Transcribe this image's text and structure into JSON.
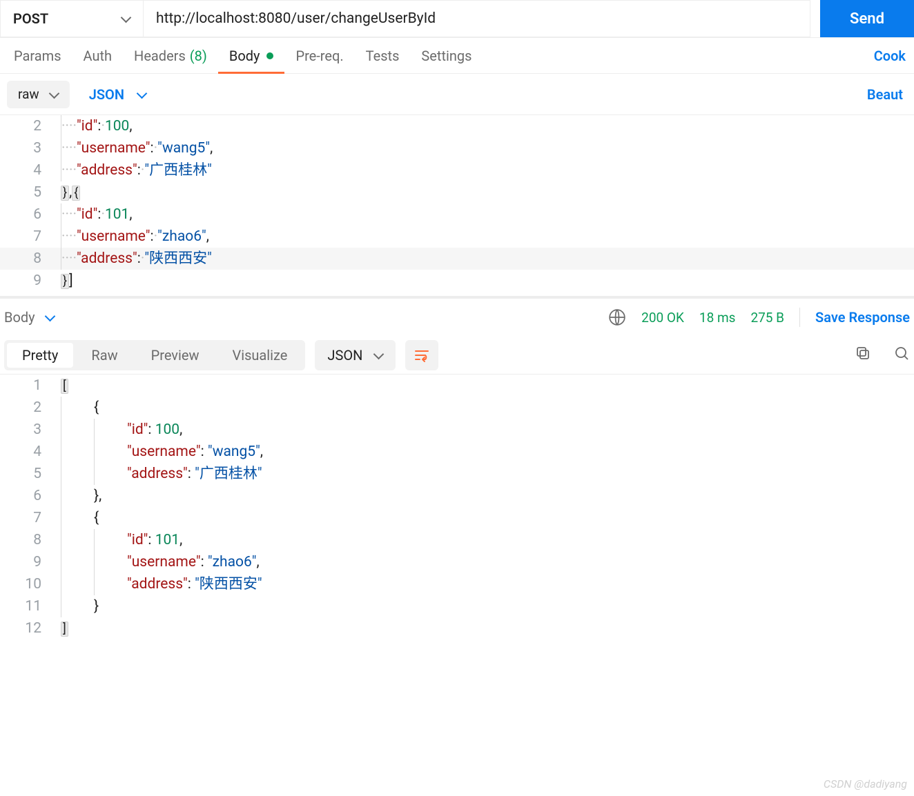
{
  "request": {
    "method": "POST",
    "url": "http://localhost:8080/user/changeUserById",
    "send_label": "Send"
  },
  "tabs": {
    "params": "Params",
    "auth": "Auth",
    "headers": "Headers",
    "headers_count": "(8)",
    "body": "Body",
    "prereq": "Pre-req.",
    "tests": "Tests",
    "settings": "Settings",
    "cookies": "Cook"
  },
  "body_toolbar": {
    "raw": "raw",
    "format": "JSON",
    "beautify": "Beaut"
  },
  "request_editor": {
    "lines": [
      {
        "n": "2",
        "dots": "····",
        "key": "\"id\"",
        "sep": ":·",
        "val": "100",
        "val_type": "num",
        "tail": ","
      },
      {
        "n": "3",
        "dots": "····",
        "key": "\"username\"",
        "sep": ":·",
        "val": "\"wang5\"",
        "val_type": "str",
        "tail": ","
      },
      {
        "n": "4",
        "dots": "····",
        "key": "\"address\"",
        "sep": ":·",
        "val": "\"广西桂林\"",
        "val_type": "str",
        "tail": ""
      },
      {
        "n": "5",
        "raw": "},{",
        "fold": true
      },
      {
        "n": "6",
        "dots": "····",
        "key": "\"id\"",
        "sep": ":·",
        "val": "101",
        "val_type": "num",
        "tail": ","
      },
      {
        "n": "7",
        "dots": "····",
        "key": "\"username\"",
        "sep": ":·",
        "val": "\"zhao6\"",
        "val_type": "str",
        "tail": ","
      },
      {
        "n": "8",
        "dots": "····",
        "key": "\"address\"",
        "sep": ":·",
        "val": "\"陕西西安\"",
        "val_type": "str",
        "tail": "",
        "hl": true
      },
      {
        "n": "9",
        "raw": "}]",
        "fold": true
      }
    ]
  },
  "response_bar": {
    "body_label": "Body",
    "status": "200 OK",
    "time": "18 ms",
    "size": "275 B",
    "save": "Save Response"
  },
  "response_tabs": {
    "pretty": "Pretty",
    "raw": "Raw",
    "preview": "Preview",
    "visualize": "Visualize",
    "format": "JSON"
  },
  "response_editor": {
    "lines": [
      {
        "n": "1",
        "indent": 0,
        "raw": "[",
        "fold": true
      },
      {
        "n": "2",
        "indent": 1,
        "raw": "{"
      },
      {
        "n": "3",
        "indent": 2,
        "key": "\"id\"",
        "sep": ": ",
        "val": "100",
        "val_type": "num",
        "tail": ","
      },
      {
        "n": "4",
        "indent": 2,
        "key": "\"username\"",
        "sep": ": ",
        "val": "\"wang5\"",
        "val_type": "str",
        "tail": ","
      },
      {
        "n": "5",
        "indent": 2,
        "key": "\"address\"",
        "sep": ": ",
        "val": "\"广西桂林\"",
        "val_type": "str",
        "tail": ""
      },
      {
        "n": "6",
        "indent": 1,
        "raw": "},"
      },
      {
        "n": "7",
        "indent": 1,
        "raw": "{"
      },
      {
        "n": "8",
        "indent": 2,
        "key": "\"id\"",
        "sep": ": ",
        "val": "101",
        "val_type": "num",
        "tail": ","
      },
      {
        "n": "9",
        "indent": 2,
        "key": "\"username\"",
        "sep": ": ",
        "val": "\"zhao6\"",
        "val_type": "str",
        "tail": ","
      },
      {
        "n": "10",
        "indent": 2,
        "key": "\"address\"",
        "sep": ": ",
        "val": "\"陕西西安\"",
        "val_type": "str",
        "tail": ""
      },
      {
        "n": "11",
        "indent": 1,
        "raw": "}"
      },
      {
        "n": "12",
        "indent": 0,
        "raw": "]",
        "fold": true
      }
    ]
  },
  "watermark": "CSDN @dadiyang"
}
